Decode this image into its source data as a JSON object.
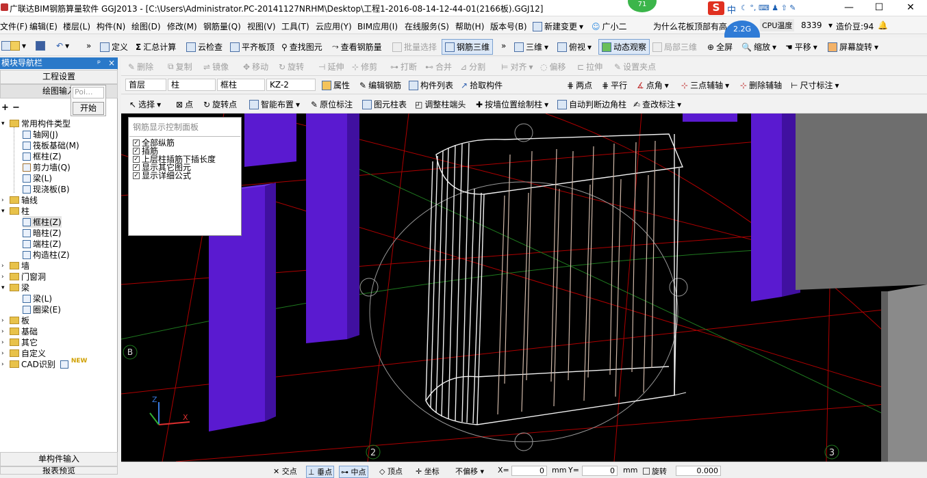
{
  "window": {
    "title": "广联达BIM钢筋算量软件 GGJ2013 - [C:\\Users\\Administrator.PC-20141127NRHM\\Desktop\\工程1-2016-08-14-12-44-01(2166板).GGJ12]",
    "minimize": "—",
    "maximize": "☐",
    "close": "✕",
    "badge": "71"
  },
  "ime": {
    "logo": "S",
    "mode": "中",
    "cpu": "CPU温度",
    "cpu_val": "2.2G",
    "notice": "为什么花板顶部有高",
    "user": "8339",
    "price": "造价豆:94"
  },
  "menu": [
    "文件(F)",
    "编辑(E)",
    "楼层(L)",
    "构件(N)",
    "绘图(D)",
    "修改(M)",
    "钢筋量(Q)",
    "视图(V)",
    "工具(T)",
    "云应用(Y)",
    "BIM应用(I)",
    "在线服务(S)",
    "帮助(H)",
    "版本号(B)",
    "新建变更",
    "广小二"
  ],
  "toolbar1": [
    "定义",
    "汇总计算",
    "云检查",
    "平齐板顶",
    "查找图元",
    "查看钢筋量",
    "批量选择",
    "钢筋三维",
    "三维",
    "俯视",
    "动态观察",
    "局部三维",
    "全屏",
    "缩放",
    "平移",
    "屏幕旋转"
  ],
  "toolbar2": [
    "删除",
    "复制",
    "镜像",
    "移动",
    "旋转",
    "延伸",
    "修剪",
    "打断",
    "合并",
    "分割",
    "对齐",
    "偏移",
    "拉伸",
    "设置夹点"
  ],
  "toolbar3": {
    "floor": "首层",
    "type": "柱",
    "sub": "框柱",
    "id": "KZ-2",
    "items": [
      "属性",
      "编辑钢筋",
      "构件列表",
      "拾取构件",
      "两点",
      "平行",
      "点角",
      "三点辅轴",
      "删除辅轴",
      "尺寸标注"
    ]
  },
  "toolbar4": [
    "选择",
    "点",
    "旋转点",
    "智能布置",
    "原位标注",
    "图元柱表",
    "调整柱端头",
    "按墙位置绘制柱",
    "自动判断边角柱",
    "查改标注"
  ],
  "nav": {
    "title": "模块导航栏",
    "pin": "ᵖ",
    "close": "×",
    "settings": "工程设置",
    "drawing": "绘图输入",
    "plus": "+",
    "minus": "−",
    "single": "单构件输入",
    "report": "报表预览"
  },
  "popup": {
    "input": "Poi...",
    "start": "开始"
  },
  "tree": [
    {
      "label": "常用构件类型",
      "level": 0,
      "icon": "folder"
    },
    {
      "label": "轴网(J)",
      "level": 1,
      "icon": "axis"
    },
    {
      "label": "筏板基础(M)",
      "level": 1,
      "icon": "raft"
    },
    {
      "label": "框柱(Z)",
      "level": 1,
      "icon": "column"
    },
    {
      "label": "剪力墙(Q)",
      "level": 1,
      "icon": "wall"
    },
    {
      "label": "梁(L)",
      "level": 1,
      "icon": "beam"
    },
    {
      "label": "现浇板(B)",
      "level": 1,
      "icon": "slab"
    },
    {
      "label": "轴线",
      "level": 0,
      "icon": "folder"
    },
    {
      "label": "柱",
      "level": 0,
      "icon": "folder"
    },
    {
      "label": "框柱(Z)",
      "level": 1,
      "icon": "column"
    },
    {
      "label": "暗柱(Z)",
      "level": 1,
      "icon": "column"
    },
    {
      "label": "端柱(Z)",
      "level": 1,
      "icon": "column"
    },
    {
      "label": "构造柱(Z)",
      "level": 1,
      "icon": "gear"
    },
    {
      "label": "墙",
      "level": 0,
      "icon": "folder"
    },
    {
      "label": "门窗洞",
      "level": 0,
      "icon": "folder"
    },
    {
      "label": "梁",
      "level": 0,
      "icon": "folder"
    },
    {
      "label": "梁(L)",
      "level": 1,
      "icon": "beam"
    },
    {
      "label": "圈梁(E)",
      "level": 1,
      "icon": "ring"
    },
    {
      "label": "板",
      "level": 0,
      "icon": "folder"
    },
    {
      "label": "基础",
      "level": 0,
      "icon": "folder"
    },
    {
      "label": "其它",
      "level": 0,
      "icon": "folder"
    },
    {
      "label": "自定义",
      "level": 0,
      "icon": "folder"
    },
    {
      "label": "CAD识别",
      "level": 0,
      "icon": "folder",
      "badge": "NEW"
    }
  ],
  "rebar_panel": {
    "title": "钢筋显示控制面板",
    "items": [
      "全部纵筋",
      "插筋",
      "上层柱插筋下插长度",
      "显示其它图元",
      "显示详细公式"
    ]
  },
  "viewport": {
    "axis_b": "B",
    "axis_2": "2",
    "axis_3": "3",
    "axis_z": "Z",
    "axis_x": "X"
  },
  "status": {
    "items": [
      "交点",
      "垂点",
      "中点",
      "顶点",
      "坐标",
      "不偏移",
      "X=",
      "0",
      "mm",
      "Y=",
      "0",
      "mm",
      "旋转",
      "0.000"
    ]
  }
}
